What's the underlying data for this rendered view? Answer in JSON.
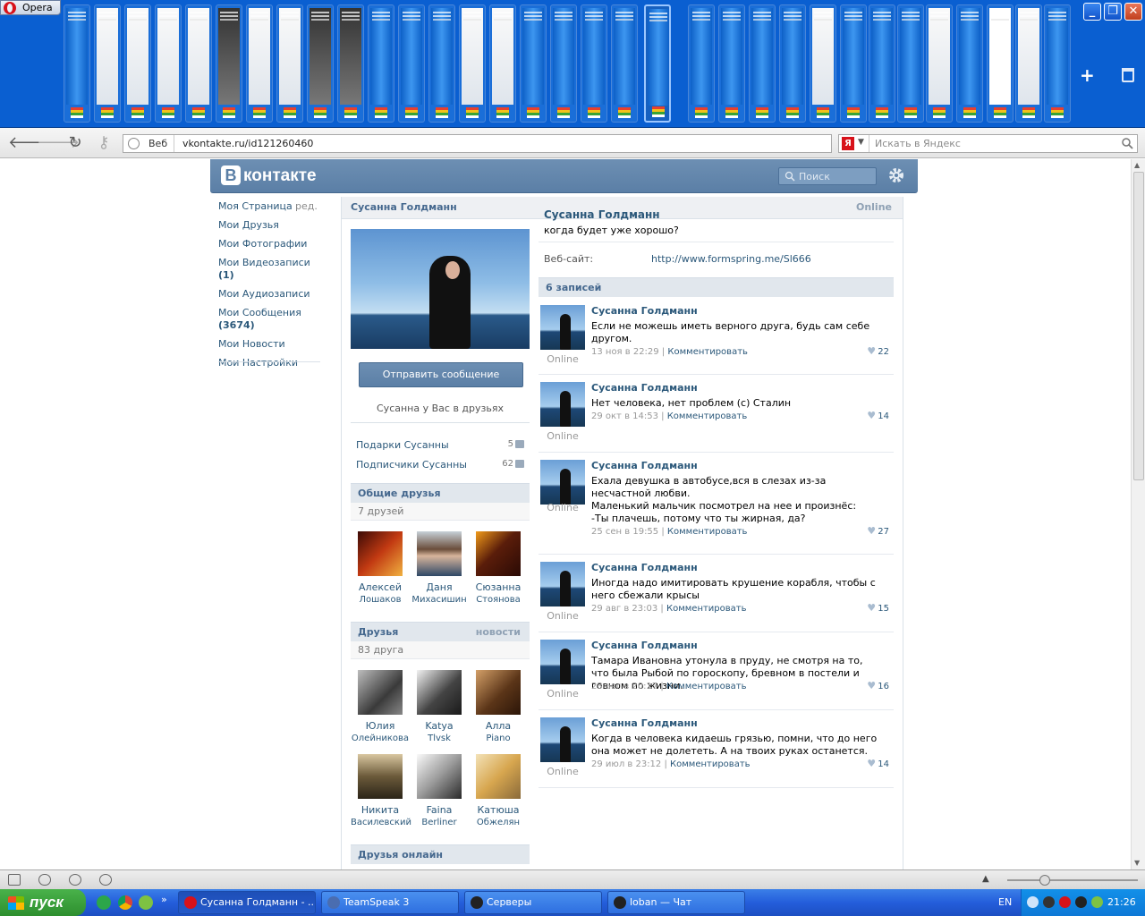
{
  "browser": {
    "menu_label": "Opera",
    "address_prefix": "Веб",
    "url": "vkontakte.ru/id121260460",
    "search_placeholder": "Искать в Яндекс"
  },
  "vk": {
    "logo": "контакте",
    "logo_letter": "В",
    "search_placeholder": "Поиск",
    "menu": {
      "my_page": "Моя Страница",
      "edit": "ред.",
      "friends": "Мои Друзья",
      "photos": "Мои Фотографии",
      "videos": "Мои Видеозаписи",
      "videos_count": "(1)",
      "audio": "Мои Аудиозаписи",
      "messages": "Мои Сообщения",
      "messages_count": "(3674)",
      "news": "Мои Новости",
      "settings": "Мои Настройки"
    },
    "profile": {
      "header_name": "Сусанна Голдманн",
      "header_status": "Online",
      "send_message": "Отправить сообщение",
      "in_friends": "Сусанна у Вас в друзьях",
      "gifts_label": "Подарки Сусанны",
      "gifts_count": "5",
      "followers_label": "Подписчики Сусанны",
      "followers_count": "62",
      "name": "Сусанна Голдманн",
      "status": "когда будет уже хорошо?",
      "website_label": "Веб-сайт:",
      "website": "http://www.formspring.me/Sl666"
    },
    "common_friends": {
      "title": "Общие друзья",
      "count": "7 друзей",
      "items": [
        {
          "first": "Алексей",
          "last": "Лошаков"
        },
        {
          "first": "Даня",
          "last": "Михасишин"
        },
        {
          "first": "Сюзанна",
          "last": "Стоянова"
        }
      ]
    },
    "friends": {
      "title": "Друзья",
      "news_link": "новости",
      "count": "83 друга",
      "items": [
        {
          "first": "Юлия",
          "last": "Олейникова"
        },
        {
          "first": "Katya",
          "last": "Tlvsk"
        },
        {
          "first": "Алла",
          "last": "Piano"
        },
        {
          "first": "Никита",
          "last": "Василевский"
        },
        {
          "first": "Faina",
          "last": "Berliner"
        },
        {
          "first": "Катюша",
          "last": "Обжелян"
        }
      ]
    },
    "friends_online": {
      "title": "Друзья онлайн"
    },
    "wall": {
      "title": "6 записей",
      "comment_label": "Комментировать",
      "online_label": "Online",
      "posts": [
        {
          "author": "Сусанна Голдманн",
          "text": "Если не можешь иметь верного друга, будь сам себе другом.",
          "date": "13 ноя в 22:29",
          "likes": "22"
        },
        {
          "author": "Сусанна Голдманн",
          "text": "Нет человека, нет проблем (с) Сталин",
          "date": "29 окт в 14:53",
          "likes": "14"
        },
        {
          "author": "Сусанна Голдманн",
          "text": "Ехала девушка в автобусе,вся в слезах из-за несчастной любви.\nМаленький мальчик посмотрел на нее и произнёс:\n-Ты плачешь, потому что ты жирная, да?",
          "date": "25 сен в 19:55",
          "likes": "27"
        },
        {
          "author": "Сусанна Голдманн",
          "text": "Иногда надо имитировать крушение корабля, чтобы с него сбежали крысы",
          "date": "29 авг в 23:03",
          "likes": "15"
        },
        {
          "author": "Сусанна Голдманн",
          "text": "Тамара Ивановна утонула в пруду, не смотря на то, что была Рыбой по гороскопу, бревном в постели и говном по жизни.",
          "date": "23 авг в 20:17",
          "likes": "16"
        },
        {
          "author": "Сусанна Голдманн",
          "text": "Когда в человека кидаешь грязью, помни, что до него она может не долететь. А на твоих руках останется.",
          "date": "29 июл в 23:12",
          "likes": "14"
        }
      ]
    }
  },
  "taskbar": {
    "start": "пуск",
    "tasks": [
      {
        "label": "Сусанна Голдманн - ..."
      },
      {
        "label": "TeamSpeak 3"
      },
      {
        "label": "Серверы"
      },
      {
        "label": "loban — Чат"
      }
    ],
    "lang": "EN",
    "clock": "21:26"
  }
}
